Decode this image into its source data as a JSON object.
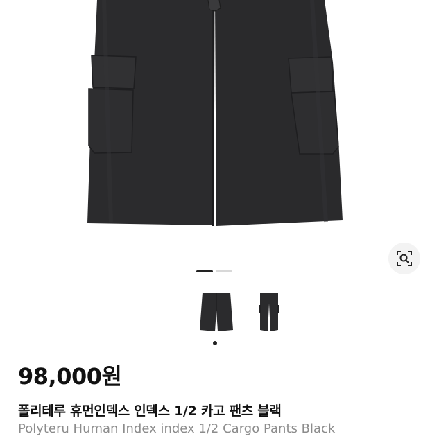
{
  "product": {
    "price": "98,000원",
    "title_ko": "폴리테루 휴먼인덱스 인덱스 1/2 카고 팬츠 블랙",
    "title_en": "Polyteru Human Index index 1/2 Cargo Pants Black"
  },
  "gallery": {
    "image_count": 2,
    "active_index": 0,
    "hero_icon": "image-search-icon",
    "thumbnails": [
      {
        "icon": "shorts-thumbnail"
      },
      {
        "icon": "long-pants-thumbnail"
      }
    ]
  },
  "colors": {
    "garment": "#2b2b2d",
    "indicator_active": "#222222",
    "indicator_inactive": "#d8d8d8",
    "subtitle_gray": "#8c8c8c"
  }
}
